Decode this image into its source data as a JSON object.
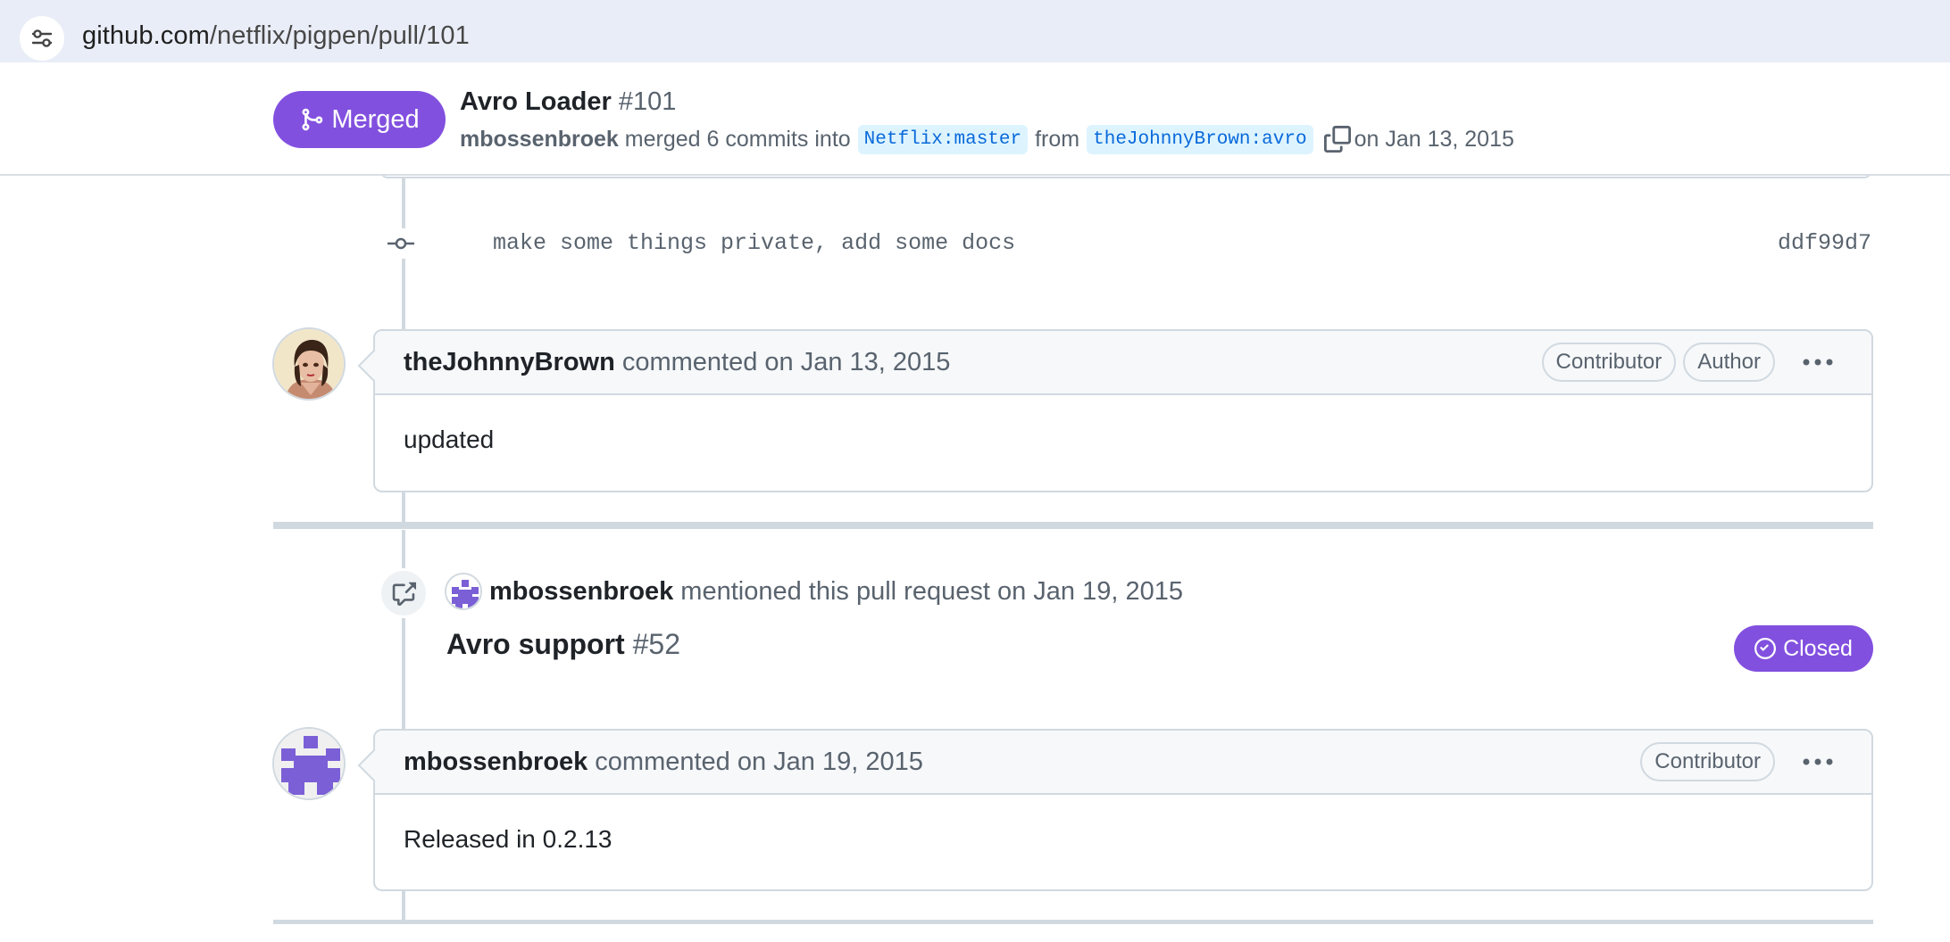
{
  "browser": {
    "url_host": "github.com",
    "url_path": "/netflix/pigpen/pull/101"
  },
  "pr": {
    "status": "Merged",
    "title": "Avro Loader",
    "number": "#101",
    "merger": "mbossenbroek",
    "merge_text": "merged 6 commits into",
    "base_branch": "Netflix:master",
    "from_text": "from",
    "head_branch": "theJohnnyBrown:avro",
    "date_text": "on Jan 13, 2015"
  },
  "commit": {
    "message": "make some things private, add some docs",
    "sha": "ddf99d7"
  },
  "comments": [
    {
      "author": "theJohnnyBrown",
      "action": "commented on Jan 13, 2015",
      "roles": [
        "Contributor",
        "Author"
      ],
      "body": "updated"
    },
    {
      "author": "mbossenbroek",
      "action": "commented on Jan 19, 2015",
      "roles": [
        "Contributor"
      ],
      "body": "Released in 0.2.13"
    }
  ],
  "mention": {
    "user": "mbossenbroek",
    "text": "mentioned this pull request on Jan 19, 2015",
    "ref_title": "Avro support",
    "ref_number": "#52",
    "ref_status": "Closed"
  },
  "colors": {
    "merged_purple": "#8250df",
    "branch_blue": "#0969da",
    "border": "#d1d9e0"
  }
}
